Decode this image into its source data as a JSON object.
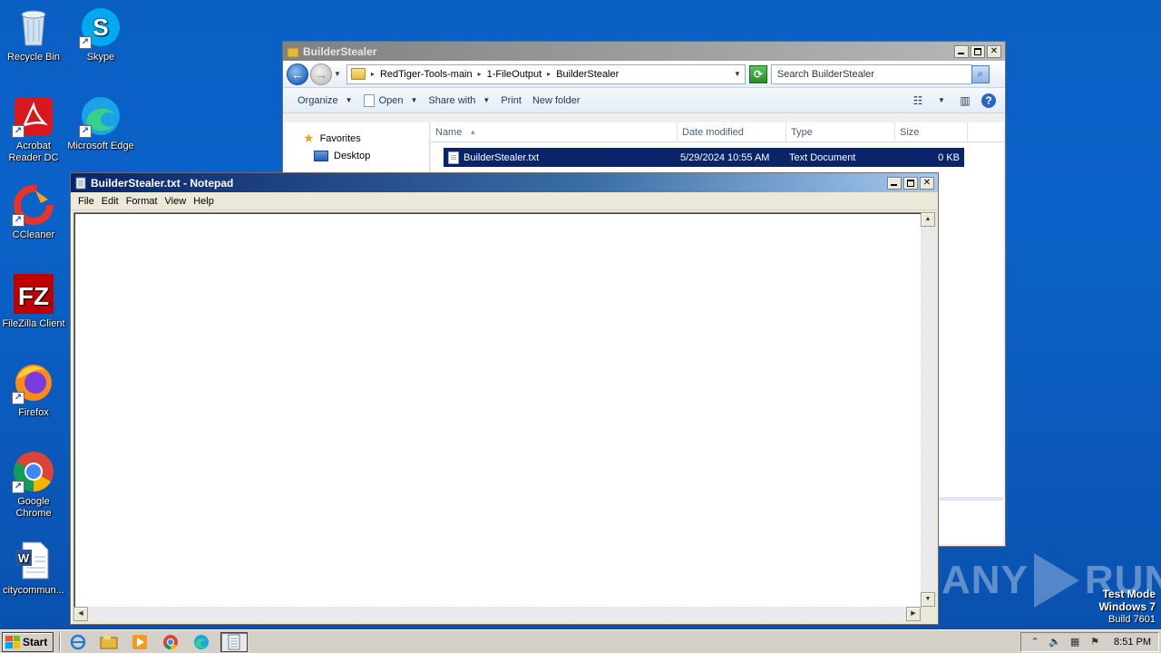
{
  "desktop": {
    "icons": [
      {
        "label": "Recycle Bin"
      },
      {
        "label": "Skype"
      },
      {
        "label": "Acrobat Reader DC"
      },
      {
        "label": "Microsoft Edge"
      },
      {
        "label": "CCleaner"
      },
      {
        "label": "FileZilla Client"
      },
      {
        "label": "Firefox"
      },
      {
        "label": "Google Chrome"
      },
      {
        "label": "citycommun..."
      }
    ]
  },
  "explorer": {
    "title": "BuilderStealer",
    "breadcrumb": [
      "RedTiger-Tools-main",
      "1-FileOutput",
      "BuilderStealer"
    ],
    "search_placeholder": "Search BuilderStealer",
    "commands": {
      "organize": "Organize",
      "open": "Open",
      "share": "Share with",
      "print": "Print",
      "new_folder": "New folder"
    },
    "nav": {
      "favorites": "Favorites",
      "desktop": "Desktop"
    },
    "columns": {
      "name": "Name",
      "date": "Date modified",
      "type": "Type",
      "size": "Size"
    },
    "files": [
      {
        "name": "BuilderStealer.txt",
        "date": "5/29/2024 10:55 AM",
        "type": "Text Document",
        "size": "0 KB"
      }
    ]
  },
  "notepad": {
    "title": "BuilderStealer.txt - Notepad",
    "menu": {
      "file": "File",
      "edit": "Edit",
      "format": "Format",
      "view": "View",
      "help": "Help"
    },
    "content": ""
  },
  "watermark": {
    "left": "ANY",
    "right": "RUN"
  },
  "testmode": {
    "line1": "Test Mode",
    "line2": "Windows 7",
    "line3": "Build 7601"
  },
  "taskbar": {
    "start": "Start",
    "clock": "8:51 PM"
  }
}
